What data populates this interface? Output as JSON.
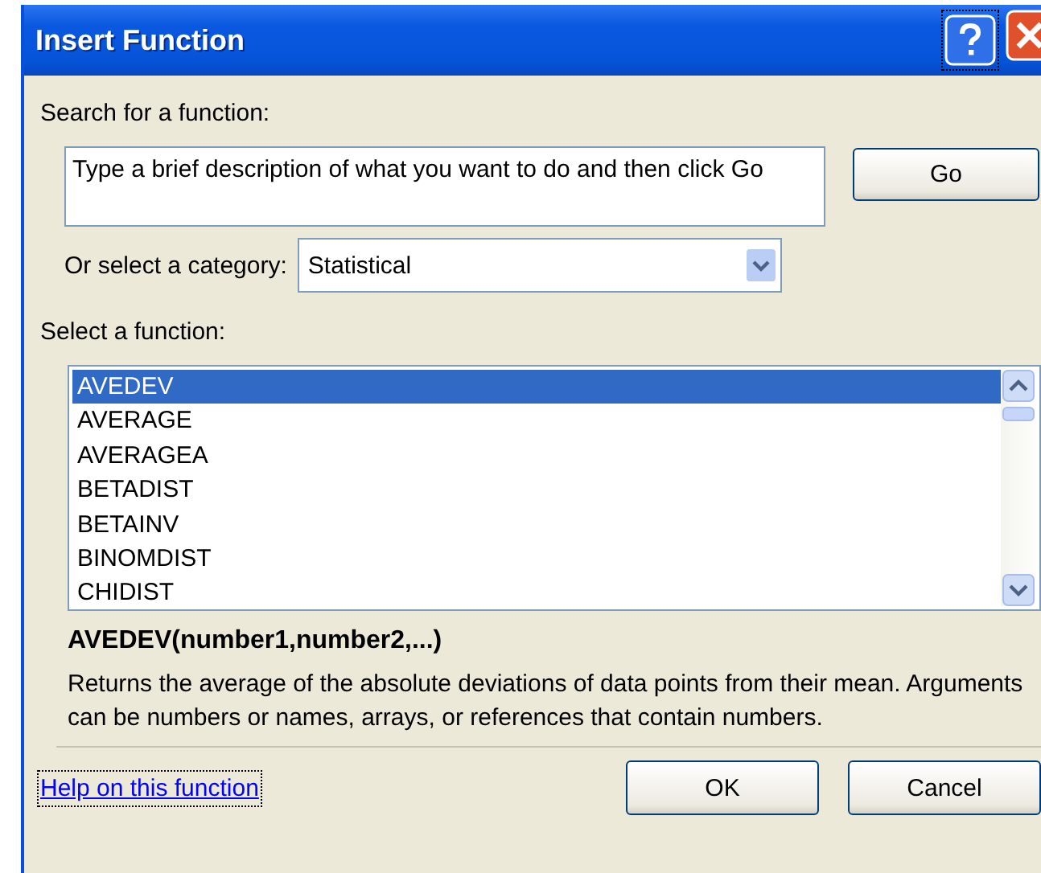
{
  "window": {
    "title": "Insert Function"
  },
  "search": {
    "label": "Search for a function:",
    "value": "Type a brief description of what you want to do and then click Go",
    "button": "Go"
  },
  "category": {
    "label": "Or select a category:",
    "value": "Statistical"
  },
  "functions": {
    "label": "Select a function:",
    "items": [
      {
        "name": "AVEDEV",
        "selected": true
      },
      {
        "name": "AVERAGE",
        "selected": false
      },
      {
        "name": "AVERAGEA",
        "selected": false
      },
      {
        "name": "BETADIST",
        "selected": false
      },
      {
        "name": "BETAINV",
        "selected": false
      },
      {
        "name": "BINOMDIST",
        "selected": false
      },
      {
        "name": "CHIDIST",
        "selected": false
      }
    ]
  },
  "signature": "AVEDEV(number1,number2,...)",
  "description": "Returns the average of the absolute deviations of data points from their mean. Arguments can be numbers or names, arrays, or references that contain numbers.",
  "help_link": "Help on this function",
  "buttons": [
    "OK",
    "Cancel"
  ]
}
